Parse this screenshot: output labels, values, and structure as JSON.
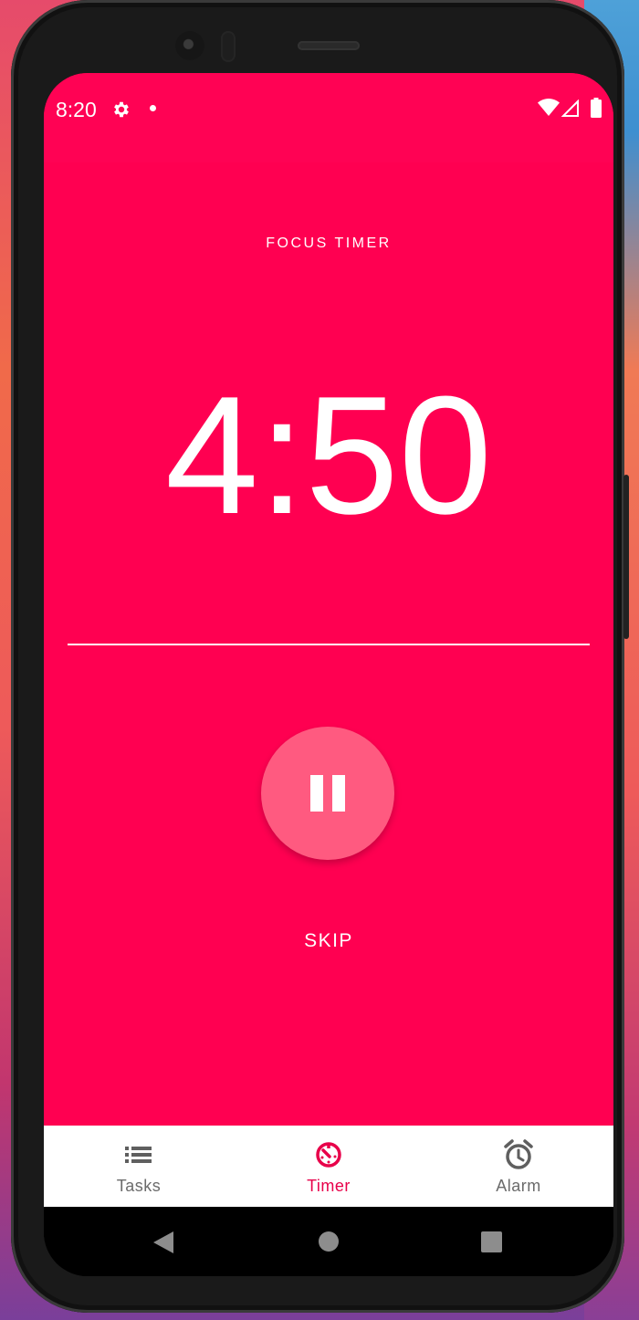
{
  "status_bar": {
    "time": "8:20",
    "icons": [
      "gear-icon",
      "notification-dot-icon",
      "wifi-icon",
      "signal-icon",
      "battery-icon"
    ]
  },
  "timer": {
    "label": "FOCUS TIMER",
    "remaining": "4:50",
    "pause_icon": "pause-icon",
    "skip_label": "SKIP"
  },
  "bottom_nav": {
    "items": [
      {
        "label": "Tasks",
        "icon": "list-icon",
        "active": false
      },
      {
        "label": "Timer",
        "icon": "timer-icon",
        "active": true
      },
      {
        "label": "Alarm",
        "icon": "alarm-clock-icon",
        "active": false
      }
    ]
  },
  "system_nav": {
    "icons": [
      "back-icon",
      "home-icon",
      "recents-icon"
    ]
  },
  "colors": {
    "primary": "#ff0051",
    "pause_button": "#ff5a80",
    "active_nav": "#e8004a",
    "inactive_nav": "#6b6b6b"
  }
}
